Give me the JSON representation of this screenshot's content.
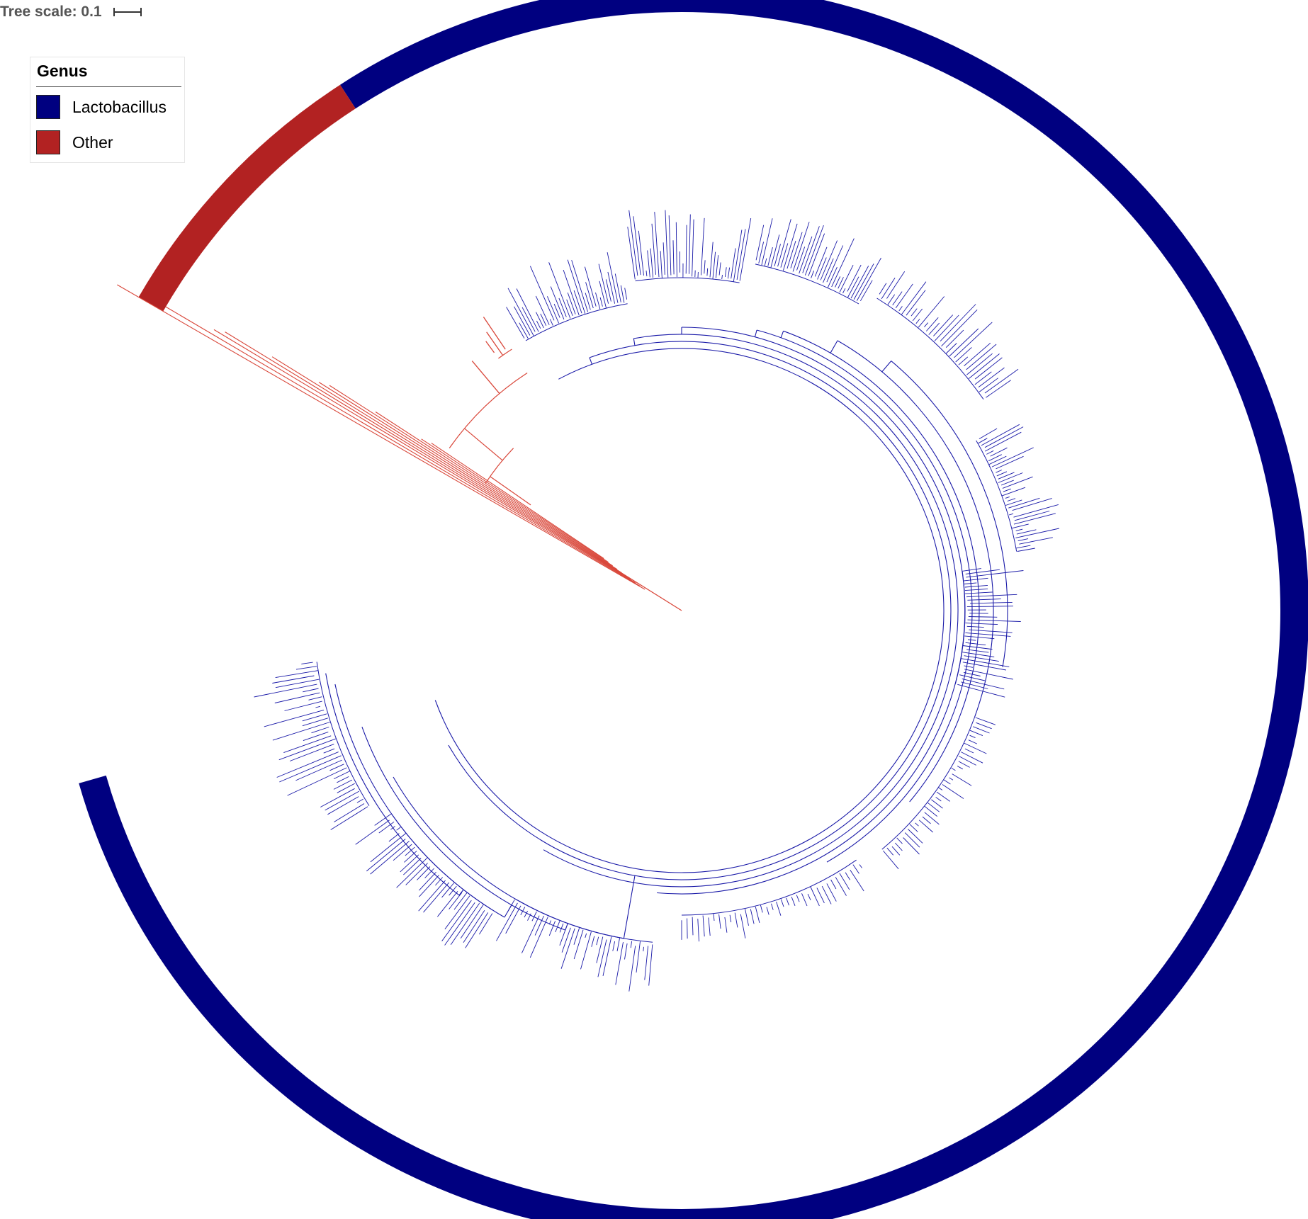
{
  "tree_scale": {
    "label": "Tree scale: 0.1"
  },
  "legend": {
    "title": "Genus",
    "items": [
      {
        "label": "Lactobacillus",
        "color": "#000080"
      },
      {
        "label": "Other",
        "color": "#b22222"
      }
    ]
  },
  "colors": {
    "lactobacillus": "#000080",
    "other": "#b22222",
    "branch_lacto": "#1a1aa8",
    "branch_other": "#d9473a"
  }
}
